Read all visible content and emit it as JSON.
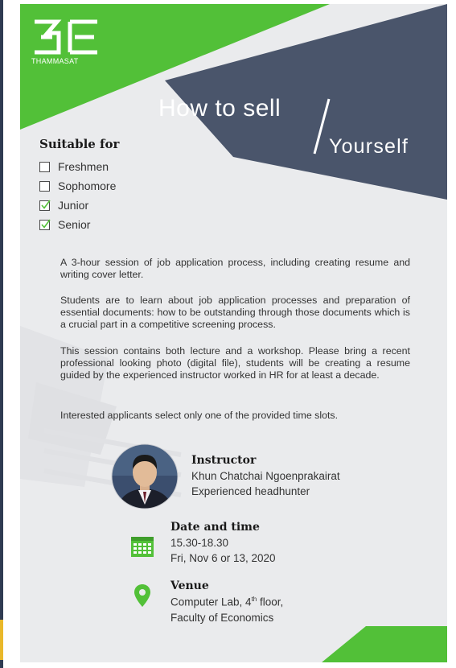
{
  "logo": {
    "mark": "BE",
    "subtitle": "THAMMASAT"
  },
  "title": {
    "line1": "How to sell",
    "line2": "Yourself"
  },
  "suitable": {
    "heading": "Suitable for",
    "options": [
      {
        "label": "Freshmen",
        "checked": false
      },
      {
        "label": "Sophomore",
        "checked": false
      },
      {
        "label": "Junior",
        "checked": true
      },
      {
        "label": "Senior",
        "checked": true
      }
    ]
  },
  "description": [
    "A 3-hour session of job application process, including creating resume and writing cover letter.",
    "Students are to learn about job application processes and preparation of essential documents: how to be outstanding through those documents which is a crucial part in a competitive screening process.",
    "This session contains both lecture and a workshop. Please bring a recent professional looking  photo (digital file), students will be creating a resume guided by the experienced instructor worked in HR for at least a decade.",
    "Interested applicants select only one of the provided time slots."
  ],
  "instructor": {
    "heading": "Instructor",
    "name": "Khun Chatchai Ngoenprakairat",
    "role": "Experienced headhunter"
  },
  "datetime": {
    "heading": "Date and time",
    "time": "15.30-18.30",
    "dates": "Fri, Nov 6 or 13, 2020"
  },
  "venue": {
    "heading": "Venue",
    "room": "Computer Lab, 4",
    "room_sup": "th",
    "room_suffix": " floor,",
    "faculty": "Faculty of Economics"
  },
  "colors": {
    "green": "#52c038",
    "slate": "#4a556b",
    "background": "#eaebed"
  },
  "icons": [
    "calendar-icon",
    "location-pin-icon",
    "checkbox-icon",
    "check-icon"
  ]
}
